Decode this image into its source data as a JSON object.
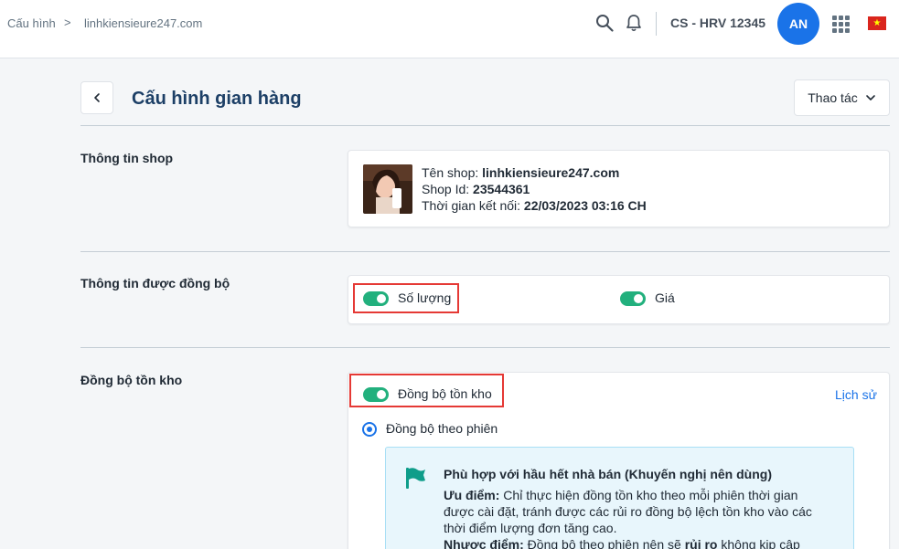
{
  "breadcrumb": {
    "root": "Cấu hình",
    "separator": ">",
    "current": "linhkiensieure247.com"
  },
  "topbar": {
    "account_name": "CS - HRV 12345",
    "avatar_initials": "AN",
    "icons": [
      "search-icon",
      "bell-icon",
      "apps-grid-icon",
      "vietnam-flag-icon"
    ]
  },
  "page": {
    "title": "Cấu hình gian hàng",
    "action_button": "Thao tác"
  },
  "shop_info": {
    "section_label": "Thông tin shop",
    "name_label": "Tên shop: ",
    "name_value": "linhkiensieure247.com",
    "id_label": "Shop Id: ",
    "id_value": "23544361",
    "connected_label": "Thời gian kết nối: ",
    "connected_value": "22/03/2023 03:16 CH"
  },
  "sync_info": {
    "section_label": "Thông tin được đồng bộ",
    "quantity_label": "Số lượng",
    "quantity_enabled": true,
    "price_label": "Giá",
    "price_enabled": true
  },
  "stock_sync": {
    "section_label": "Đồng bộ tồn kho",
    "toggle_label": "Đồng bộ tồn kho",
    "toggle_enabled": true,
    "history_link": "Lịch sử",
    "radio_label": "Đồng bộ theo phiên",
    "radio_selected": true,
    "recommend_title": "Phù hợp với hầu hết nhà bán (Khuyến nghị nên dùng)",
    "pros_label": "Ưu điểm:",
    "pros_text": " Chỉ thực hiện đồng tồn kho theo mỗi phiên thời gian được cài đặt, tránh được các rủi ro đồng bộ lệch tồn kho vào các thời điểm lượng đơn tăng cao.",
    "cons_label": "Nhược điểm:",
    "cons_text_1": " Đồng bộ theo phiên nên sẽ ",
    "cons_bold": "rủi ro",
    "cons_text_2": " không kịp cập nhật"
  },
  "colors": {
    "primary": "#1a73e8",
    "toggle_on": "#22b07d",
    "highlight": "#e53935",
    "info_bg": "#e8f6fc",
    "title": "#1c3f66"
  }
}
